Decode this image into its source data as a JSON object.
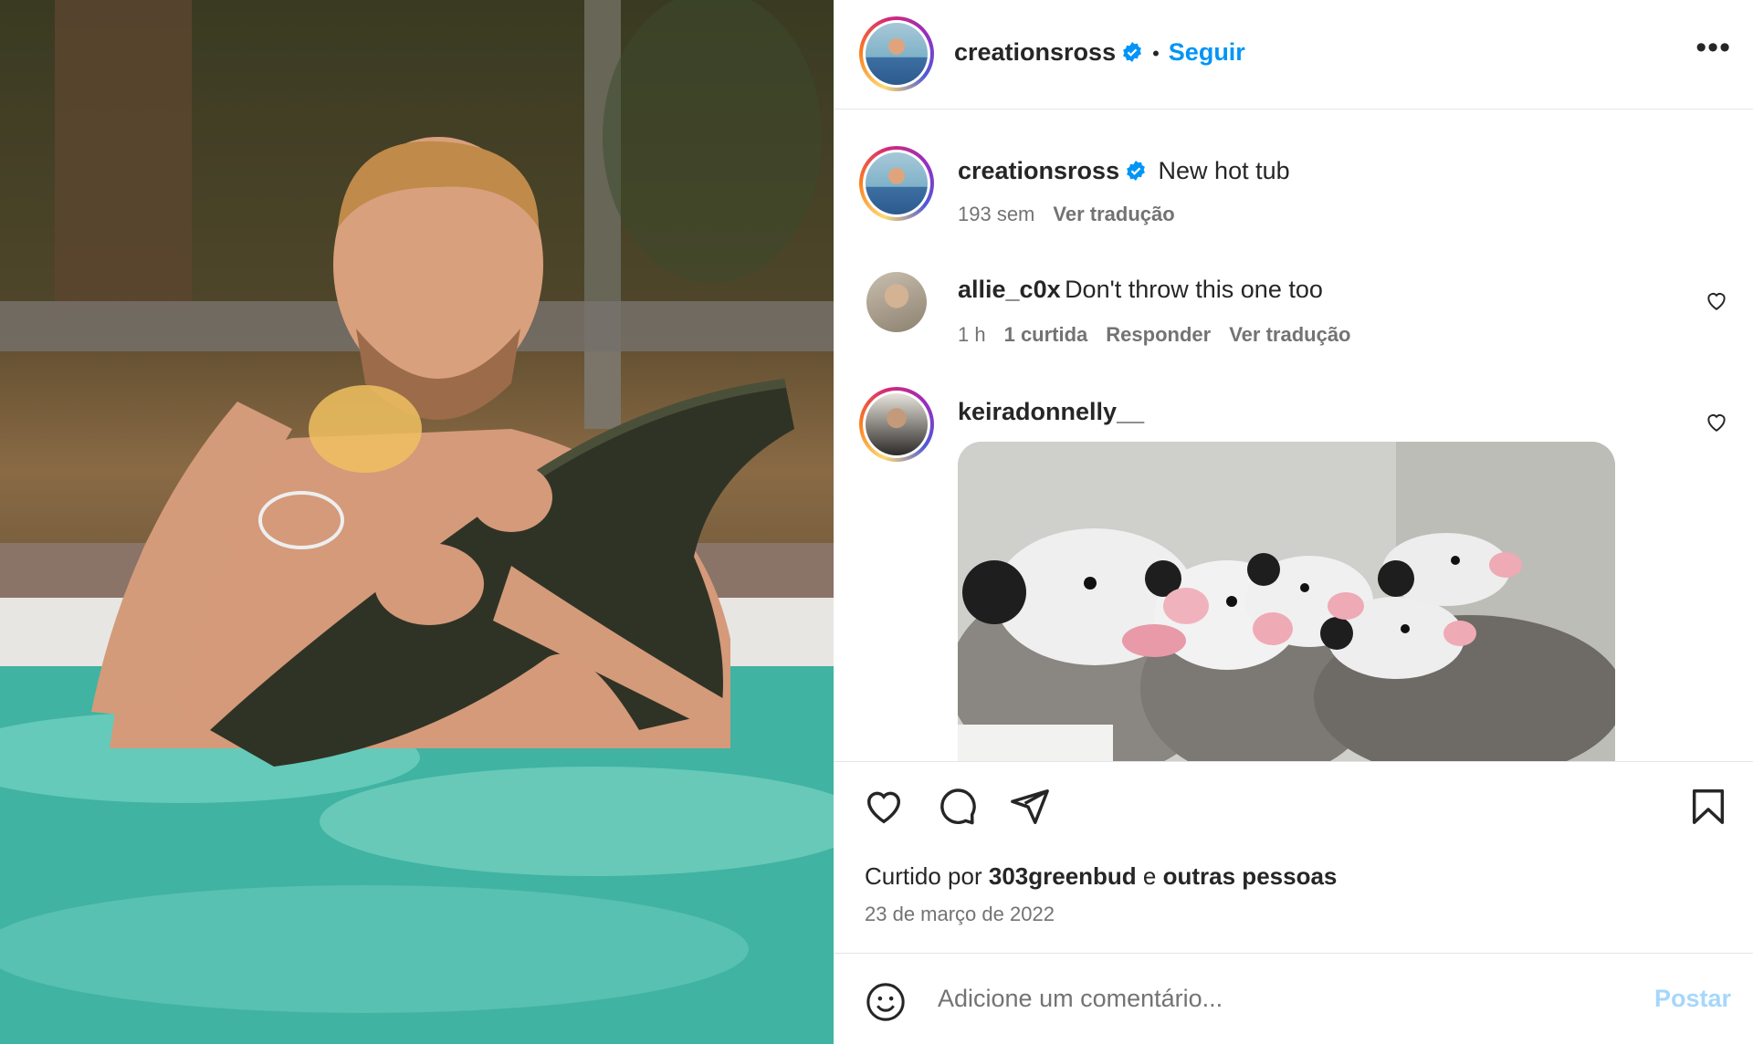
{
  "header": {
    "username": "creationsross",
    "separator": "•",
    "follow_label": "Seguir",
    "more_label": "•••"
  },
  "caption": {
    "username": "creationsross",
    "text": "New hot tub",
    "age": "193 sem",
    "translate_label": "Ver tradução"
  },
  "comments": [
    {
      "username": "allie_c0x",
      "text": "Don't throw this one too",
      "age": "1 h",
      "likes": "1 curtida",
      "reply_label": "Responder",
      "translate_label": "Ver tradução"
    },
    {
      "username": "keiradonnelly__",
      "text": ""
    }
  ],
  "actions": {
    "liked_prefix": "Curtido por",
    "liked_user": "303greenbud",
    "liked_middle": "e",
    "liked_others": "outras pessoas",
    "date": "23 de março de 2022"
  },
  "comment_box": {
    "placeholder": "Adicione um comentário...",
    "post_label": "Postar"
  },
  "colors": {
    "accent": "#0095f6",
    "post_disabled": "#a6d7fb",
    "text_secondary": "#737373"
  },
  "icons": {
    "verified": "verified-badge-icon",
    "like": "heart-icon",
    "comment": "comment-bubble-icon",
    "share": "paper-plane-icon",
    "save": "bookmark-icon",
    "emoji": "smiley-icon",
    "more": "more-options-icon"
  }
}
